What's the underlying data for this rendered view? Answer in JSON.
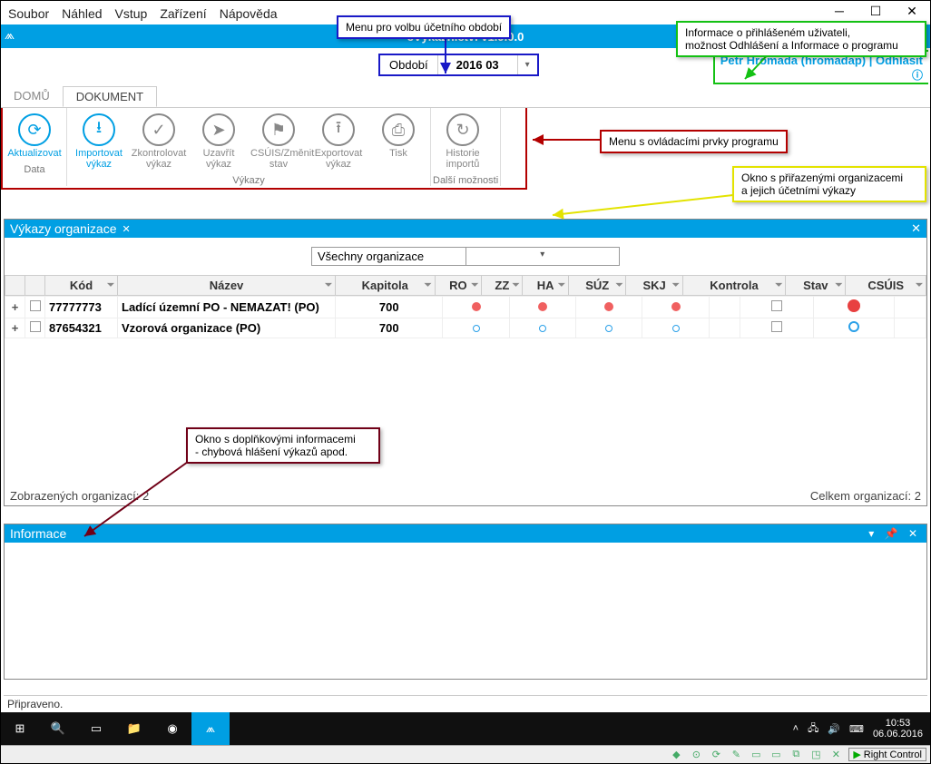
{
  "menubar": [
    "Soubor",
    "Náhled",
    "Vstup",
    "Zařízení",
    "Nápověda"
  ],
  "window": {
    "title": "eVýkaznictví v1.9.0.0"
  },
  "period": {
    "label": "Období",
    "value": "2016 03"
  },
  "user": {
    "line": "Petr Hromada (hromadap) | Odhlásit"
  },
  "tabs": [
    "DOMŮ",
    "DOKUMENT"
  ],
  "ribbon": {
    "data": {
      "btn0": "Aktualizovat",
      "label": "Data"
    },
    "vykazy": {
      "b1": "Importovat výkaz",
      "b2": "Zkontrolovat výkaz",
      "b3": "Uzavřít výkaz",
      "b4": "CSÚIS/Změnit stav",
      "b5": "Exportovat výkaz",
      "b6": "Tisk",
      "label": "Výkazy"
    },
    "dalsi": {
      "b7": "Historie importů",
      "label": "Další možnosti"
    }
  },
  "callouts": {
    "period": "Menu pro volbu účetního období",
    "user": "Informace o přihlášeném uživateli,\nmožnost Odhlášení a Informace o programu",
    "ribbon": "Menu s ovládacími prvky programu",
    "grid": "Okno s přiřazenými organizacemi\na jejich účetními výkazy",
    "info": "Okno s doplňkovými informacemi\n- chybová hlášení výkazů apod."
  },
  "grid": {
    "title": "Výkazy organizace",
    "filter": "Všechny organizace",
    "cols": [
      "",
      "",
      "Kód",
      "Název",
      "Kapitola",
      "RO",
      "ZZ",
      "HA",
      "SÚZ",
      "SKJ",
      "Kontrola",
      "Stav",
      "CSÚIS"
    ],
    "rows": [
      {
        "kod": "77777773",
        "nazev": "Ladící územní PO - NEMAZAT! (PO)",
        "kapitola": "700",
        "ro": "rf",
        "zz": "rf",
        "ha": "rf",
        "suz": "rf",
        "skj": "",
        "kontrola": "chk",
        "stav": "bigred",
        "csuis": ""
      },
      {
        "kod": "87654321",
        "nazev": "Vzorová organizace (PO)",
        "kapitola": "700",
        "ro": "bo",
        "zz": "bo",
        "ha": "bo",
        "suz": "bo",
        "skj": "",
        "kontrola": "chk",
        "stav": "bigblueo",
        "csuis": ""
      }
    ],
    "footerL": "Zobrazených organizací: 2",
    "footerR": "Celkem organizací: 2"
  },
  "info": {
    "title": "Informace"
  },
  "status": "Připraveno.",
  "taskbar": {
    "time": "10:53",
    "date": "06.06.2016"
  },
  "remote": {
    "label": "Right Control"
  }
}
